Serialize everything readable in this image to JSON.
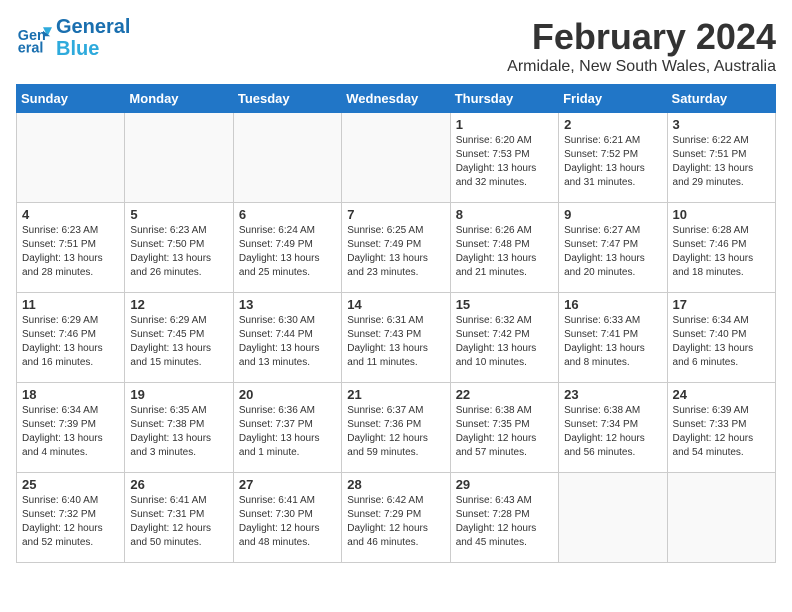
{
  "logo": {
    "line1": "General",
    "line2": "Blue"
  },
  "title": "February 2024",
  "subtitle": "Armidale, New South Wales, Australia",
  "days_of_week": [
    "Sunday",
    "Monday",
    "Tuesday",
    "Wednesday",
    "Thursday",
    "Friday",
    "Saturday"
  ],
  "weeks": [
    [
      {
        "num": "",
        "info": ""
      },
      {
        "num": "",
        "info": ""
      },
      {
        "num": "",
        "info": ""
      },
      {
        "num": "",
        "info": ""
      },
      {
        "num": "1",
        "info": "Sunrise: 6:20 AM\nSunset: 7:53 PM\nDaylight: 13 hours\nand 32 minutes."
      },
      {
        "num": "2",
        "info": "Sunrise: 6:21 AM\nSunset: 7:52 PM\nDaylight: 13 hours\nand 31 minutes."
      },
      {
        "num": "3",
        "info": "Sunrise: 6:22 AM\nSunset: 7:51 PM\nDaylight: 13 hours\nand 29 minutes."
      }
    ],
    [
      {
        "num": "4",
        "info": "Sunrise: 6:23 AM\nSunset: 7:51 PM\nDaylight: 13 hours\nand 28 minutes."
      },
      {
        "num": "5",
        "info": "Sunrise: 6:23 AM\nSunset: 7:50 PM\nDaylight: 13 hours\nand 26 minutes."
      },
      {
        "num": "6",
        "info": "Sunrise: 6:24 AM\nSunset: 7:49 PM\nDaylight: 13 hours\nand 25 minutes."
      },
      {
        "num": "7",
        "info": "Sunrise: 6:25 AM\nSunset: 7:49 PM\nDaylight: 13 hours\nand 23 minutes."
      },
      {
        "num": "8",
        "info": "Sunrise: 6:26 AM\nSunset: 7:48 PM\nDaylight: 13 hours\nand 21 minutes."
      },
      {
        "num": "9",
        "info": "Sunrise: 6:27 AM\nSunset: 7:47 PM\nDaylight: 13 hours\nand 20 minutes."
      },
      {
        "num": "10",
        "info": "Sunrise: 6:28 AM\nSunset: 7:46 PM\nDaylight: 13 hours\nand 18 minutes."
      }
    ],
    [
      {
        "num": "11",
        "info": "Sunrise: 6:29 AM\nSunset: 7:46 PM\nDaylight: 13 hours\nand 16 minutes."
      },
      {
        "num": "12",
        "info": "Sunrise: 6:29 AM\nSunset: 7:45 PM\nDaylight: 13 hours\nand 15 minutes."
      },
      {
        "num": "13",
        "info": "Sunrise: 6:30 AM\nSunset: 7:44 PM\nDaylight: 13 hours\nand 13 minutes."
      },
      {
        "num": "14",
        "info": "Sunrise: 6:31 AM\nSunset: 7:43 PM\nDaylight: 13 hours\nand 11 minutes."
      },
      {
        "num": "15",
        "info": "Sunrise: 6:32 AM\nSunset: 7:42 PM\nDaylight: 13 hours\nand 10 minutes."
      },
      {
        "num": "16",
        "info": "Sunrise: 6:33 AM\nSunset: 7:41 PM\nDaylight: 13 hours\nand 8 minutes."
      },
      {
        "num": "17",
        "info": "Sunrise: 6:34 AM\nSunset: 7:40 PM\nDaylight: 13 hours\nand 6 minutes."
      }
    ],
    [
      {
        "num": "18",
        "info": "Sunrise: 6:34 AM\nSunset: 7:39 PM\nDaylight: 13 hours\nand 4 minutes."
      },
      {
        "num": "19",
        "info": "Sunrise: 6:35 AM\nSunset: 7:38 PM\nDaylight: 13 hours\nand 3 minutes."
      },
      {
        "num": "20",
        "info": "Sunrise: 6:36 AM\nSunset: 7:37 PM\nDaylight: 13 hours\nand 1 minute."
      },
      {
        "num": "21",
        "info": "Sunrise: 6:37 AM\nSunset: 7:36 PM\nDaylight: 12 hours\nand 59 minutes."
      },
      {
        "num": "22",
        "info": "Sunrise: 6:38 AM\nSunset: 7:35 PM\nDaylight: 12 hours\nand 57 minutes."
      },
      {
        "num": "23",
        "info": "Sunrise: 6:38 AM\nSunset: 7:34 PM\nDaylight: 12 hours\nand 56 minutes."
      },
      {
        "num": "24",
        "info": "Sunrise: 6:39 AM\nSunset: 7:33 PM\nDaylight: 12 hours\nand 54 minutes."
      }
    ],
    [
      {
        "num": "25",
        "info": "Sunrise: 6:40 AM\nSunset: 7:32 PM\nDaylight: 12 hours\nand 52 minutes."
      },
      {
        "num": "26",
        "info": "Sunrise: 6:41 AM\nSunset: 7:31 PM\nDaylight: 12 hours\nand 50 minutes."
      },
      {
        "num": "27",
        "info": "Sunrise: 6:41 AM\nSunset: 7:30 PM\nDaylight: 12 hours\nand 48 minutes."
      },
      {
        "num": "28",
        "info": "Sunrise: 6:42 AM\nSunset: 7:29 PM\nDaylight: 12 hours\nand 46 minutes."
      },
      {
        "num": "29",
        "info": "Sunrise: 6:43 AM\nSunset: 7:28 PM\nDaylight: 12 hours\nand 45 minutes."
      },
      {
        "num": "",
        "info": ""
      },
      {
        "num": "",
        "info": ""
      }
    ]
  ]
}
